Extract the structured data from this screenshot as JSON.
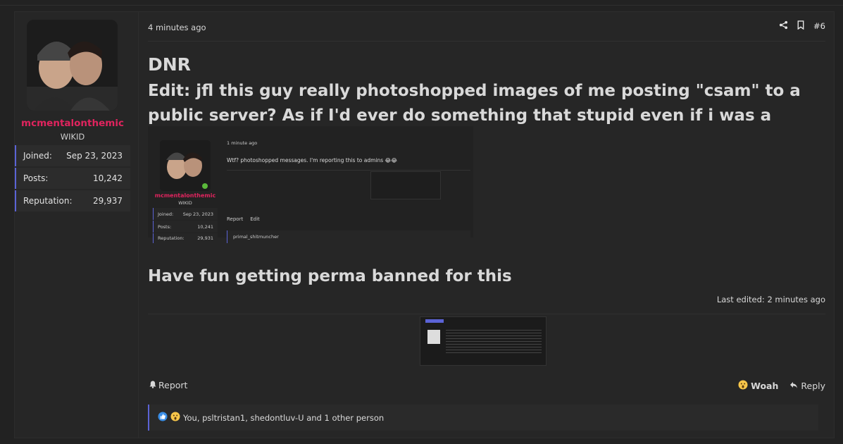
{
  "user": {
    "name": "mcmentalonthemic",
    "title": "WIKID",
    "stats": [
      {
        "label": "Joined:",
        "value": "Sep 23, 2023"
      },
      {
        "label": "Posts:",
        "value": "10,242"
      },
      {
        "label": "Reputation:",
        "value": "29,937"
      }
    ]
  },
  "post": {
    "time": "4 minutes ago",
    "number": "#6",
    "heading": "DNR",
    "edit_text": "Edit: jfl this guy really photoshopped images of me posting \"csam\" to a public server? As if I'd ever do something that stupid even if i was a paedo",
    "followup": "Have fun getting perma banned for this",
    "last_edited": "Last edited: 2 minutes ago",
    "report_label": "Report",
    "woah_label": "Woah",
    "reply_label": "Reply",
    "reactions_text": "You, psltristan1, shedontluv-U and 1 other person"
  },
  "embed": {
    "username": "mcmentalonthemic",
    "title": "WIKID",
    "time": "1 minute ago",
    "text": "Wtf? photoshopped messages. I'm reporting this to admins 😂😂",
    "stats": [
      {
        "label": "Joined:",
        "value": "Sep 23, 2023"
      },
      {
        "label": "Posts:",
        "value": "10,241"
      },
      {
        "label": "Reputation:",
        "value": "29,931"
      }
    ],
    "report_label": "Report",
    "edit_label": "Edit",
    "reaction_user": "primal_shitmuncher"
  },
  "colors": {
    "username": "#e0245e",
    "accent": "#5b63d6"
  }
}
